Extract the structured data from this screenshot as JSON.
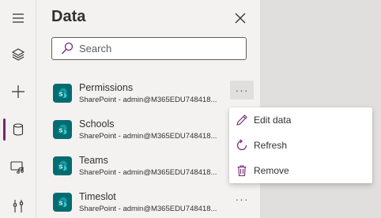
{
  "panel": {
    "title": "Data",
    "search_placeholder": "Search"
  },
  "rail": {
    "items": [
      {
        "icon": "hamburger-menu-icon"
      },
      {
        "icon": "layers-icon"
      },
      {
        "icon": "plus-icon"
      },
      {
        "icon": "database-icon",
        "active": true
      },
      {
        "icon": "media-icon"
      },
      {
        "icon": "tools-icon"
      }
    ]
  },
  "data_sources": [
    {
      "name": "Permissions",
      "subtitle": "SharePoint - admin@M365EDU748418...",
      "icon": "sharepoint-icon"
    },
    {
      "name": "Schools",
      "subtitle": "SharePoint - admin@M365EDU748418...",
      "icon": "sharepoint-icon"
    },
    {
      "name": "Teams",
      "subtitle": "SharePoint - admin@M365EDU748418...",
      "icon": "sharepoint-icon"
    },
    {
      "name": "Timeslot",
      "subtitle": "SharePoint - admin@M365EDU748418...",
      "icon": "sharepoint-icon"
    }
  ],
  "more_button_label": "···",
  "context_menu": {
    "items": [
      {
        "label": "Edit data",
        "icon": "pencil-icon"
      },
      {
        "label": "Refresh",
        "icon": "refresh-icon"
      },
      {
        "label": "Remove",
        "icon": "trash-icon"
      }
    ]
  },
  "colors": {
    "accent": "#742774",
    "sharepoint": "#036c70"
  }
}
